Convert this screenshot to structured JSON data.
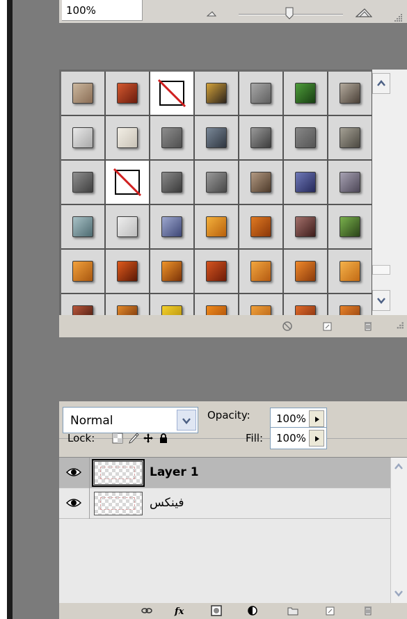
{
  "navigator": {
    "zoom": "100%"
  },
  "styles": {
    "swatches": [
      {
        "c1": "#cbb79e",
        "c2": "#8a6d55"
      },
      {
        "c1": "#d4582f",
        "c2": "#6a1c0d"
      },
      {
        "none": true
      },
      {
        "c1": "#d3a23a",
        "c2": "#2c241c"
      },
      {
        "c1": "#a8a8a8",
        "c2": "#5f5f5f"
      },
      {
        "c1": "#4e9d3a",
        "c2": "#173d12"
      },
      {
        "c1": "#b4ab9e",
        "c2": "#4a4037"
      },
      {
        "c1": "#e9e9e9",
        "c2": "#a8a8a8"
      },
      {
        "c1": "#f2eee5",
        "c2": "#c9c3b7"
      },
      {
        "c1": "#8d8d8d",
        "c2": "#4f4f4f"
      },
      {
        "c1": "#7a8898",
        "c2": "#2f3640"
      },
      {
        "c1": "#9a9a9a",
        "c2": "#3c3c3c"
      },
      {
        "c1": "#878787",
        "c2": "#555555"
      },
      {
        "c1": "#a5a195",
        "c2": "#4b4840"
      },
      {
        "c1": "#8f8f8f",
        "c2": "#3f3f3f"
      },
      {
        "none": true
      },
      {
        "c1": "#8a8a8a",
        "c2": "#3a3a3a"
      },
      {
        "c1": "#9a9a9a",
        "c2": "#484848"
      },
      {
        "c1": "#b39a83",
        "c2": "#4d3a2a"
      },
      {
        "c1": "#6f79b8",
        "c2": "#25295a"
      },
      {
        "c1": "#a7a2b3",
        "c2": "#4d4757"
      },
      {
        "c1": "#a9c2c7",
        "c2": "#4d6a70"
      },
      {
        "c1": "#eeeeee",
        "c2": "#bdbdbd"
      },
      {
        "c1": "#9ea8cf",
        "c2": "#3d4675"
      },
      {
        "c1": "#f4b13c",
        "c2": "#b8600c"
      },
      {
        "c1": "#e07a22",
        "c2": "#8a3608"
      },
      {
        "c1": "#a3706b",
        "c2": "#3d1c1a"
      },
      {
        "c1": "#7ab14d",
        "c2": "#294317"
      },
      {
        "c1": "#f2a13c",
        "c2": "#a85710"
      },
      {
        "c1": "#e05a1c",
        "c2": "#5a1805"
      },
      {
        "c1": "#f0952a",
        "c2": "#7a3208"
      },
      {
        "c1": "#d5541f",
        "c2": "#6d1c08"
      },
      {
        "c1": "#f2a63e",
        "c2": "#b45a12"
      },
      {
        "c1": "#f0892a",
        "c2": "#8a3a0c"
      },
      {
        "c1": "#f5b24a",
        "c2": "#c26a14"
      },
      {
        "c1": "#b9563b",
        "c2": "#3a1209"
      },
      {
        "c1": "#e48a2a",
        "c2": "#6a2a08"
      },
      {
        "c1": "#f3d02c",
        "c2": "#b08a08"
      },
      {
        "c1": "#f08a1c",
        "c2": "#a44a08"
      },
      {
        "c1": "#f0a03a",
        "c2": "#b05c12"
      },
      {
        "c1": "#e06a2a",
        "c2": "#7a2a0c"
      },
      {
        "c1": "#e8832a",
        "c2": "#8a3a0c"
      }
    ]
  },
  "layers": {
    "blend_mode": "Normal",
    "opacity_label": "Opacity:",
    "opacity_value": "100%",
    "lock_label": "Lock:",
    "fill_label": "Fill:",
    "fill_value": "100%",
    "items": [
      {
        "name": "Layer 1",
        "selected": true
      },
      {
        "name": "فینکس",
        "selected": false
      }
    ]
  }
}
